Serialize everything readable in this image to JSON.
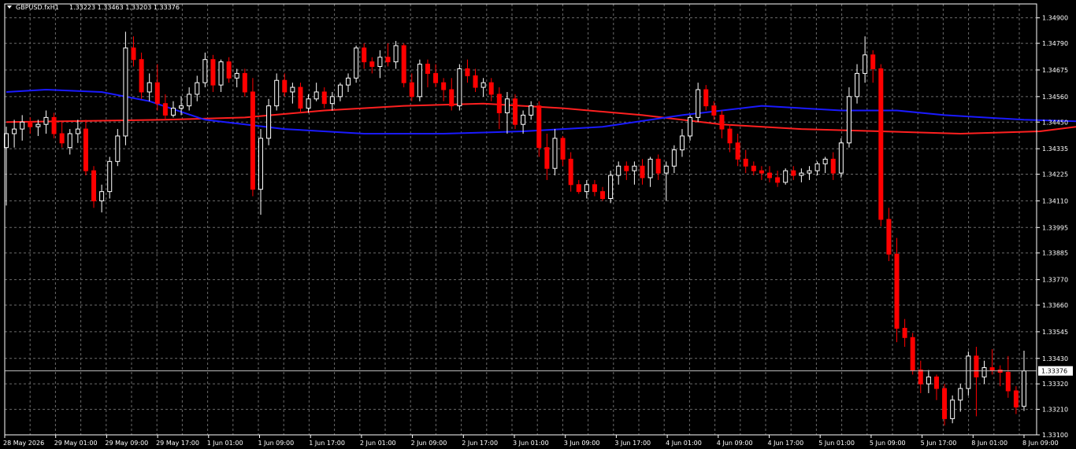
{
  "window": {
    "symbol_label": "GBPUSD.fxH1",
    "ohlc_label": "1.33223 1.33463 1.33203 1.33376",
    "menu_icon": "triangle-down-icon"
  },
  "colors": {
    "background": "#000000",
    "grid": "#6b6b6b",
    "axis": "#ffffff",
    "bull": "#ffffff",
    "bear": "#ff0000",
    "ma_fast": "#ff2020",
    "ma_slow": "#1a1aff",
    "price_line": "#bfbfbf"
  },
  "chart_data": {
    "type": "candlestick",
    "title": "GBPUSD.fxH1",
    "ylim": [
      1.331,
      1.3496
    ],
    "y_ticks": [
      "1.34900",
      "1.34790",
      "1.34675",
      "1.34560",
      "1.34450",
      "1.34335",
      "1.34225",
      "1.34110",
      "1.33995",
      "1.33885",
      "1.33770",
      "1.33660",
      "1.33545",
      "1.33430",
      "1.33320",
      "1.33210",
      "1.33100"
    ],
    "x_ticks": [
      "28 May 2026",
      "29 May 01:00",
      "29 May 09:00",
      "29 May 17:00",
      "1 Jun 01:00",
      "1 Jun 09:00",
      "1 Jun 17:00",
      "2 Jun 01:00",
      "2 Jun 09:00",
      "2 Jun 17:00",
      "3 Jun 01:00",
      "3 Jun 09:00",
      "3 Jun 17:00",
      "4 Jun 01:00",
      "4 Jun 09:00",
      "4 Jun 17:00",
      "5 Jun 01:00",
      "5 Jun 09:00",
      "5 Jun 17:00",
      "8 Jun 01:00",
      "8 Jun 09:00"
    ],
    "current_price": "1.33376",
    "ohlc": [
      [
        1.3434,
        1.3443,
        1.3409,
        1.344
      ],
      [
        1.344,
        1.3446,
        1.3434,
        1.3442
      ],
      [
        1.3442,
        1.3448,
        1.3437,
        1.3445
      ],
      [
        1.3445,
        1.3447,
        1.344,
        1.3443
      ],
      [
        1.3443,
        1.3446,
        1.3439,
        1.3444
      ],
      [
        1.3444,
        1.345,
        1.344,
        1.3447
      ],
      [
        1.3447,
        1.3449,
        1.3438,
        1.344
      ],
      [
        1.344,
        1.3445,
        1.3434,
        1.3436
      ],
      [
        1.3434,
        1.3442,
        1.3431,
        1.344
      ],
      [
        1.344,
        1.3446,
        1.3436,
        1.3442
      ],
      [
        1.3442,
        1.3446,
        1.3422,
        1.3424
      ],
      [
        1.3424,
        1.3426,
        1.3408,
        1.3411
      ],
      [
        1.3411,
        1.3418,
        1.3406,
        1.3415
      ],
      [
        1.3415,
        1.343,
        1.3412,
        1.3428
      ],
      [
        1.3428,
        1.3442,
        1.3426,
        1.3439
      ],
      [
        1.3439,
        1.3484,
        1.3435,
        1.3477
      ],
      [
        1.3477,
        1.3482,
        1.3469,
        1.3472
      ],
      [
        1.3472,
        1.3475,
        1.3455,
        1.3458
      ],
      [
        1.3458,
        1.3466,
        1.3454,
        1.3462
      ],
      [
        1.3462,
        1.347,
        1.345,
        1.3453
      ],
      [
        1.3453,
        1.3457,
        1.3446,
        1.3448
      ],
      [
        1.3448,
        1.3454,
        1.3447,
        1.3451
      ],
      [
        1.3451,
        1.3456,
        1.3448,
        1.3452
      ],
      [
        1.3452,
        1.346,
        1.345,
        1.3457
      ],
      [
        1.3457,
        1.3465,
        1.3454,
        1.3462
      ],
      [
        1.3462,
        1.3475,
        1.346,
        1.3472
      ],
      [
        1.3472,
        1.3474,
        1.3458,
        1.3461
      ],
      [
        1.3461,
        1.3472,
        1.3458,
        1.3471
      ],
      [
        1.3471,
        1.3473,
        1.3462,
        1.3464
      ],
      [
        1.3464,
        1.3468,
        1.346,
        1.3466
      ],
      [
        1.3466,
        1.3468,
        1.3456,
        1.3458
      ],
      [
        1.3458,
        1.3464,
        1.3413,
        1.3416
      ],
      [
        1.3416,
        1.3442,
        1.3405,
        1.3438
      ],
      [
        1.3438,
        1.3455,
        1.3435,
        1.3452
      ],
      [
        1.3452,
        1.3466,
        1.345,
        1.3463
      ],
      [
        1.3463,
        1.3466,
        1.3456,
        1.3458
      ],
      [
        1.3458,
        1.3462,
        1.3453,
        1.346
      ],
      [
        1.346,
        1.3462,
        1.3449,
        1.3451
      ],
      [
        1.3451,
        1.3457,
        1.3449,
        1.3455
      ],
      [
        1.3455,
        1.3462,
        1.3454,
        1.3458
      ],
      [
        1.3458,
        1.346,
        1.3451,
        1.3453
      ],
      [
        1.3453,
        1.3458,
        1.345,
        1.3456
      ],
      [
        1.3456,
        1.3462,
        1.3454,
        1.3461
      ],
      [
        1.3461,
        1.3466,
        1.3458,
        1.3464
      ],
      [
        1.3464,
        1.3478,
        1.3462,
        1.3477
      ],
      [
        1.3477,
        1.3479,
        1.3468,
        1.3471
      ],
      [
        1.3471,
        1.3473,
        1.3466,
        1.3469
      ],
      [
        1.3469,
        1.3476,
        1.3464,
        1.3473
      ],
      [
        1.3473,
        1.3479,
        1.3469,
        1.3471
      ],
      [
        1.3471,
        1.348,
        1.3468,
        1.3478
      ],
      [
        1.3478,
        1.3479,
        1.346,
        1.3462
      ],
      [
        1.3462,
        1.3466,
        1.3454,
        1.3456
      ],
      [
        1.3456,
        1.3472,
        1.3454,
        1.347
      ],
      [
        1.347,
        1.3472,
        1.346,
        1.3466
      ],
      [
        1.3466,
        1.347,
        1.346,
        1.3462
      ],
      [
        1.3462,
        1.3464,
        1.3454,
        1.3459
      ],
      [
        1.3459,
        1.3464,
        1.345,
        1.3452
      ],
      [
        1.3452,
        1.347,
        1.345,
        1.3468
      ],
      [
        1.3468,
        1.3472,
        1.3462,
        1.3465
      ],
      [
        1.3465,
        1.3468,
        1.3458,
        1.346
      ],
      [
        1.346,
        1.3464,
        1.3456,
        1.3462
      ],
      [
        1.3462,
        1.3464,
        1.3454,
        1.3457
      ],
      [
        1.3457,
        1.346,
        1.3442,
        1.3449
      ],
      [
        1.3449,
        1.3458,
        1.344,
        1.3455
      ],
      [
        1.3455,
        1.3457,
        1.3442,
        1.3444
      ],
      [
        1.3444,
        1.345,
        1.344,
        1.3448
      ],
      [
        1.3448,
        1.3454,
        1.3446,
        1.3452
      ],
      [
        1.3452,
        1.3454,
        1.343,
        1.3434
      ],
      [
        1.3434,
        1.344,
        1.342,
        1.3425
      ],
      [
        1.3425,
        1.3442,
        1.3422,
        1.3438
      ],
      [
        1.3438,
        1.3439,
        1.3426,
        1.3429
      ],
      [
        1.3429,
        1.3432,
        1.3415,
        1.3418
      ],
      [
        1.3418,
        1.342,
        1.3414,
        1.3415
      ],
      [
        1.3415,
        1.342,
        1.3412,
        1.3418
      ],
      [
        1.3418,
        1.342,
        1.3413,
        1.3415
      ],
      [
        1.3415,
        1.3417,
        1.3411,
        1.3412
      ],
      [
        1.3412,
        1.3424,
        1.341,
        1.3422
      ],
      [
        1.3422,
        1.3428,
        1.3418,
        1.3426
      ],
      [
        1.3426,
        1.3428,
        1.342,
        1.3424
      ],
      [
        1.3424,
        1.3428,
        1.3418,
        1.3426
      ],
      [
        1.3426,
        1.3429,
        1.3418,
        1.3421
      ],
      [
        1.3421,
        1.343,
        1.3417,
        1.3429
      ],
      [
        1.3429,
        1.3431,
        1.342,
        1.3423
      ],
      [
        1.3423,
        1.3428,
        1.3411,
        1.3426
      ],
      [
        1.3426,
        1.3435,
        1.3423,
        1.3433
      ],
      [
        1.3433,
        1.3442,
        1.343,
        1.3439
      ],
      [
        1.3439,
        1.3448,
        1.3437,
        1.3447
      ],
      [
        1.3447,
        1.3462,
        1.3445,
        1.3459
      ],
      [
        1.3459,
        1.3461,
        1.345,
        1.3452
      ],
      [
        1.3452,
        1.3454,
        1.3446,
        1.3448
      ],
      [
        1.3448,
        1.345,
        1.3438,
        1.3442
      ],
      [
        1.3442,
        1.3444,
        1.3432,
        1.3436
      ],
      [
        1.3436,
        1.344,
        1.3426,
        1.3429
      ],
      [
        1.3429,
        1.3433,
        1.3423,
        1.3426
      ],
      [
        1.3426,
        1.3428,
        1.3422,
        1.3424
      ],
      [
        1.3424,
        1.3426,
        1.342,
        1.3423
      ],
      [
        1.3423,
        1.3426,
        1.3419,
        1.3421
      ],
      [
        1.3421,
        1.3424,
        1.3417,
        1.3419
      ],
      [
        1.3419,
        1.3425,
        1.3418,
        1.3424
      ],
      [
        1.3424,
        1.3426,
        1.342,
        1.3422
      ],
      [
        1.3422,
        1.3425,
        1.3419,
        1.3423
      ],
      [
        1.3423,
        1.3426,
        1.342,
        1.3424
      ],
      [
        1.3424,
        1.3428,
        1.3422,
        1.3427
      ],
      [
        1.3427,
        1.343,
        1.3423,
        1.3429
      ],
      [
        1.3429,
        1.3432,
        1.342,
        1.3423
      ],
      [
        1.3423,
        1.3438,
        1.3421,
        1.3436
      ],
      [
        1.3436,
        1.346,
        1.3434,
        1.3456
      ],
      [
        1.3456,
        1.347,
        1.3453,
        1.3466
      ],
      [
        1.3466,
        1.3482,
        1.3462,
        1.3474
      ],
      [
        1.3474,
        1.3476,
        1.3462,
        1.3468
      ],
      [
        1.3468,
        1.347,
        1.34,
        1.3403
      ],
      [
        1.3403,
        1.3408,
        1.3385,
        1.3388
      ],
      [
        1.3388,
        1.3395,
        1.335,
        1.3356
      ],
      [
        1.3356,
        1.336,
        1.3348,
        1.3352
      ],
      [
        1.3352,
        1.3354,
        1.3336,
        1.3338
      ],
      [
        1.3338,
        1.3342,
        1.3328,
        1.3332
      ],
      [
        1.3332,
        1.3338,
        1.3328,
        1.3335
      ],
      [
        1.3335,
        1.3336,
        1.3325,
        1.333
      ],
      [
        1.333,
        1.3332,
        1.3314,
        1.3317
      ],
      [
        1.3317,
        1.3327,
        1.3315,
        1.3325
      ],
      [
        1.3325,
        1.3332,
        1.332,
        1.333
      ],
      [
        1.333,
        1.3346,
        1.3327,
        1.3344
      ],
      [
        1.3344,
        1.3348,
        1.3318,
        1.3335
      ],
      [
        1.3335,
        1.3342,
        1.3332,
        1.3339
      ],
      [
        1.3339,
        1.3347,
        1.3336,
        1.3338
      ],
      [
        1.3338,
        1.334,
        1.3331,
        1.3337
      ],
      [
        1.3337,
        1.3344,
        1.3326,
        1.3329
      ],
      [
        1.3329,
        1.3331,
        1.3319,
        1.3322
      ],
      [
        1.33223,
        1.33463,
        1.33203,
        1.33376
      ]
    ],
    "series": [
      {
        "color": "#ff2020",
        "points": [
          [
            0,
            1.3445
          ],
          [
            20,
            1.3446
          ],
          [
            30,
            1.3447
          ],
          [
            40,
            1.345
          ],
          [
            50,
            1.3452
          ],
          [
            60,
            1.3453
          ],
          [
            70,
            1.3451
          ],
          [
            80,
            1.3448
          ],
          [
            90,
            1.3444
          ],
          [
            100,
            1.3442
          ],
          [
            110,
            1.3441
          ],
          [
            120,
            1.344
          ],
          [
            130,
            1.3441
          ],
          [
            137,
            1.3444
          ],
          [
            142,
            1.3443
          ],
          [
            150,
            1.3438
          ],
          [
            155,
            1.3434
          ]
        ]
      },
      {
        "color": "#1a1aff",
        "points": [
          [
            0,
            1.3458
          ],
          [
            5,
            1.3459
          ],
          [
            12,
            1.3458
          ],
          [
            18,
            1.3454
          ],
          [
            25,
            1.3446
          ],
          [
            35,
            1.3442
          ],
          [
            45,
            1.344
          ],
          [
            55,
            1.344
          ],
          [
            65,
            1.3441
          ],
          [
            75,
            1.3443
          ],
          [
            85,
            1.3448
          ],
          [
            95,
            1.3452
          ],
          [
            105,
            1.345
          ],
          [
            112,
            1.345
          ],
          [
            118,
            1.3448
          ],
          [
            128,
            1.3446
          ],
          [
            138,
            1.3445
          ],
          [
            145,
            1.344
          ],
          [
            150,
            1.3432
          ],
          [
            155,
            1.3425
          ]
        ]
      }
    ]
  }
}
